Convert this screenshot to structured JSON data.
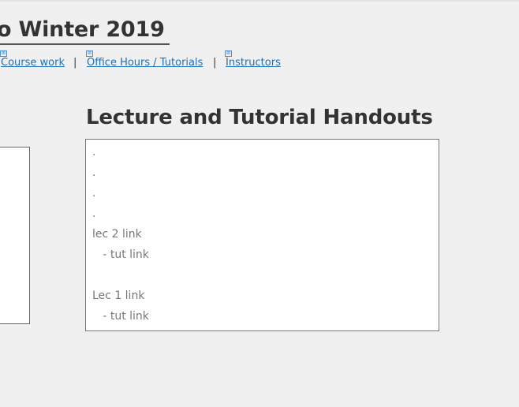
{
  "header": {
    "title": "o Winter 2019"
  },
  "nav": {
    "items": [
      {
        "label": "Course work",
        "icon": "broken-image-icon"
      },
      {
        "label": "Office Hours / Tutorials",
        "icon": "broken-image-icon"
      },
      {
        "label": "Instructors",
        "icon": "broken-image-icon"
      }
    ],
    "separator": "|"
  },
  "main": {
    "heading": "Lecture and Tutorial Handouts",
    "handouts": [
      ".",
      ".",
      ".",
      ".",
      "lec 2 link",
      "   - tut link",
      "",
      "Lec 1 link",
      "   - tut link"
    ]
  },
  "colors": {
    "link": "#1f6fb5",
    "heading": "#333333",
    "muted_text": "#777777",
    "background": "#f0f0f0"
  }
}
